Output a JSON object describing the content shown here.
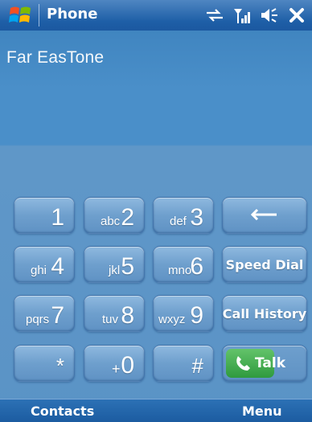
{
  "titlebar": {
    "title": "Phone",
    "icons": [
      "windows-start-icon",
      "sync-arrows-icon",
      "signal-strength-icon",
      "volume-icon",
      "close-icon"
    ]
  },
  "carrier": "Far EasTone",
  "keypad": {
    "rows": [
      [
        {
          "main": "1",
          "sub": ""
        },
        {
          "main": "2",
          "sub": "abc"
        },
        {
          "main": "3",
          "sub": "def"
        }
      ],
      [
        {
          "main": "4",
          "sub": "ghi"
        },
        {
          "main": "5",
          "sub": "jkl"
        },
        {
          "main": "6",
          "sub": "mno"
        }
      ],
      [
        {
          "main": "7",
          "sub": "pqrs"
        },
        {
          "main": "8",
          "sub": "tuv"
        },
        {
          "main": "9",
          "sub": "wxyz"
        }
      ],
      [
        {
          "main": "*",
          "sub": ""
        },
        {
          "main": "0",
          "sub": "+"
        },
        {
          "main": "#",
          "sub": ""
        }
      ]
    ],
    "actions": {
      "backspace_icon": "backspace-arrow-icon",
      "speed_dial": "Speed Dial",
      "call_history": "Call History",
      "talk": "Talk"
    }
  },
  "softkeys": {
    "left": "Contacts",
    "right": "Menu"
  },
  "colors": {
    "titlebar": "#1e5fa7",
    "background": "#4a8fc9",
    "key": "#6e9fcd",
    "talk": "#2f9a3e"
  }
}
